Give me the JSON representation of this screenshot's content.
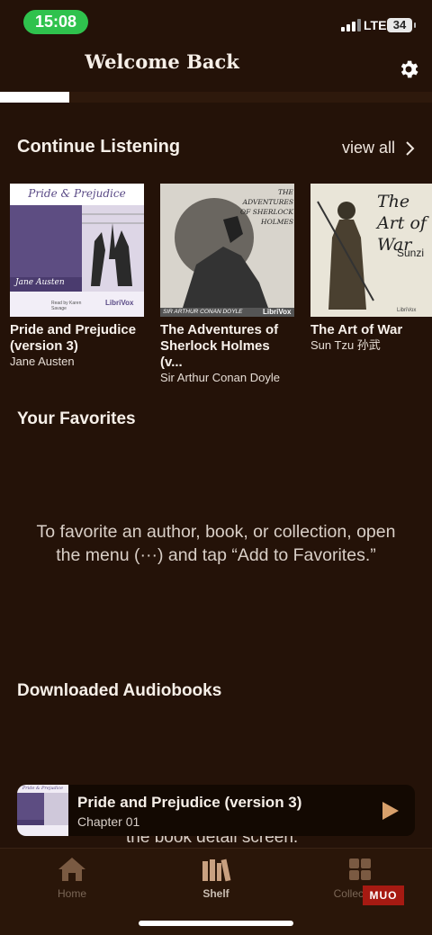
{
  "status_bar": {
    "time": "15:08",
    "network": "LTE",
    "battery": "34"
  },
  "header": {
    "title": "Welcome Back",
    "settings_icon": "gear-icon"
  },
  "download_progress": {
    "fraction": 0.16
  },
  "continue_listening": {
    "title": "Continue Listening",
    "view_all_label": "view all",
    "books": [
      {
        "title": "Pride and Prejudice (version 3)",
        "author": "Jane Austen",
        "cover_title": "Pride & Prejudice",
        "cover_author": "Jane Austen",
        "cover_publisher": "LibriVox",
        "cover_reader": "Read by Karen Savage"
      },
      {
        "title": "The Adventures of Sherlock Holmes (v...",
        "author": "Sir Arthur Conan Doyle",
        "cover_title": "THE ADVENTURES OF SHERLOCK HOLMES",
        "cover_author": "SIR ARTHUR CONAN DOYLE",
        "cover_publisher": "LibriVox"
      },
      {
        "title": "The Art of War",
        "author": "Sun Tzu 孙武",
        "cover_title": "The Art of War",
        "cover_author": "Sunzi",
        "cover_publisher": "LibriVox"
      }
    ]
  },
  "favorites": {
    "title": "Your Favorites",
    "empty_message": "To favorite an author, book, or collection, open the menu (···) and tap “Add to Favorites.”"
  },
  "downloaded": {
    "title": "Downloaded Audiobooks",
    "partial_message": "the book detail screen."
  },
  "mini_player": {
    "title": "Pride and Prejudice (version 3)",
    "subtitle": "Chapter 01",
    "cover_text": "Pride & Prejudice"
  },
  "tabs": [
    {
      "label": "Home",
      "icon": "home-icon"
    },
    {
      "label": "Shelf",
      "icon": "books-icon",
      "active": true
    },
    {
      "label": "Collections",
      "icon": "grid-icon"
    }
  ],
  "watermark": "MUO"
}
